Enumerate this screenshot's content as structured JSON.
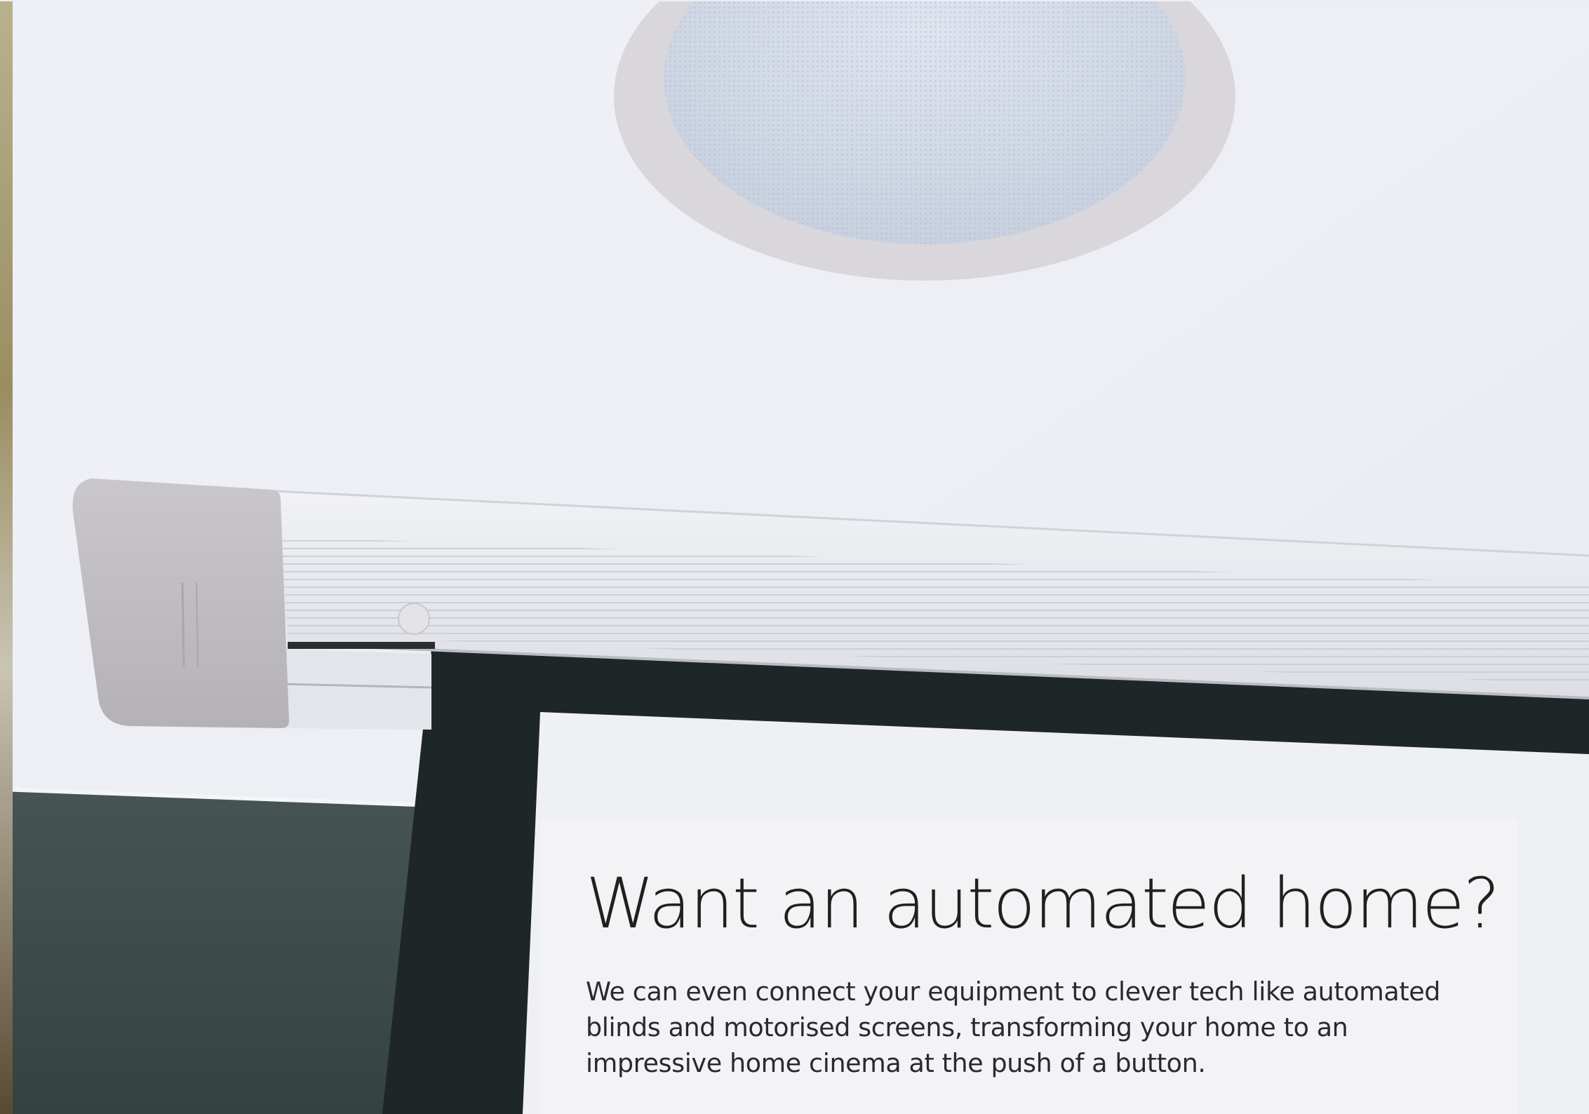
{
  "hero": {
    "headline": "Want an automated home?",
    "body": "We can even connect your equipment to clever tech like automated blinds and motorised screens, transforming your home to an impressive home cinema at the push of a button."
  },
  "colors": {
    "card_background": "#f3f3f5",
    "headline_text": "#221f20",
    "body_text": "#2a2a2d",
    "ceiling": "#eceef4",
    "wall": "#3c4a48",
    "screen_border": "#1e2627"
  }
}
